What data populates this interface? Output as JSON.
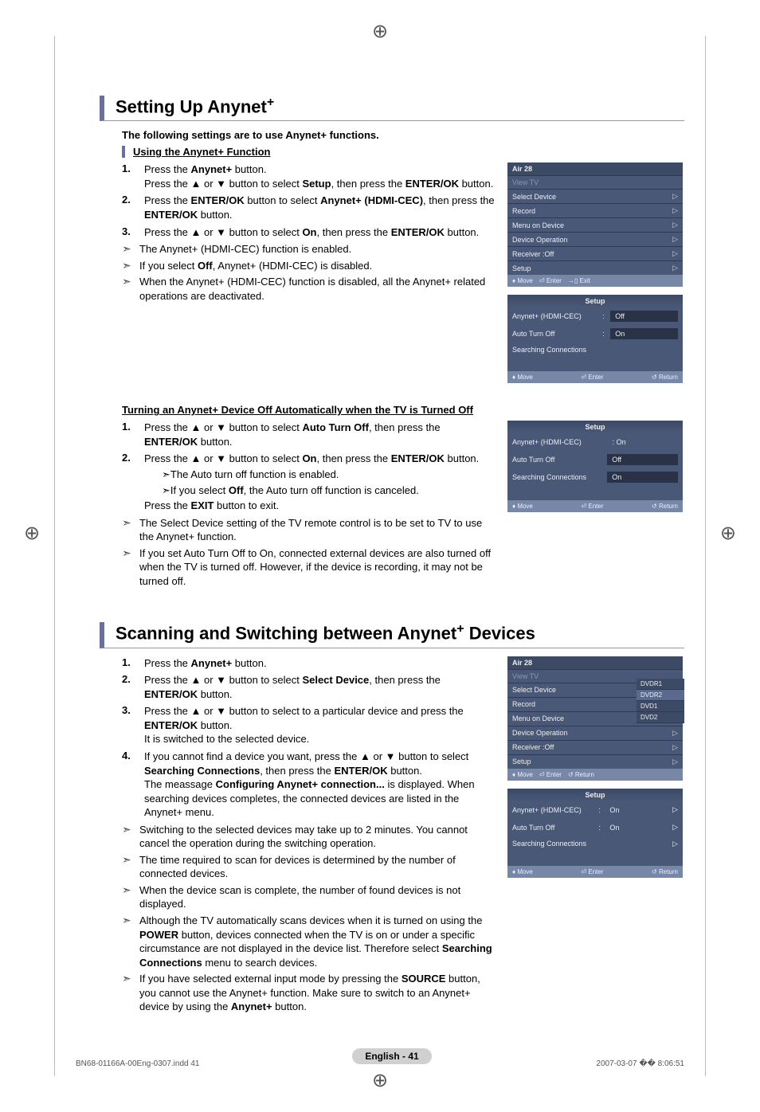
{
  "section1": {
    "title_a": "Setting Up Anynet",
    "title_sup": "+",
    "intro": "The following settings are to use Anynet+ functions.",
    "sub1": "Using the Anynet+ Function",
    "steps1": [
      {
        "n": "1.",
        "html": "Press the <b>Anynet+</b> button.<br>Press the ▲ or ▼ button to select <b>Setup</b>, then press the <b>ENTER/OK</b> button."
      },
      {
        "n": "2.",
        "html": "Press the <b>ENTER/OK</b> button to select <b>Anynet+ (HDMI-CEC)</b>, then press the <b>ENTER/OK</b> button."
      },
      {
        "n": "3.",
        "html": "Press the ▲ or ▼ button to select <b>On</b>, then press the <b>ENTER/OK</b> button."
      }
    ],
    "notes1": [
      "The Anynet+ (HDMI-CEC) function is enabled.",
      "If you select <b>Off</b>, Anynet+ (HDMI-CEC) is disabled.",
      "When the Anynet+ (HDMI-CEC) function is disabled, all the Anynet+ related operations are deactivated."
    ],
    "sub2": "Turning an Anynet+ Device Off Automatically when the TV is Turned Off",
    "steps2": [
      {
        "n": "1.",
        "html": "Press the ▲ or ▼ button to select <b>Auto Turn Off</b>, then press the <b>ENTER/OK</b> button."
      },
      {
        "n": "2.",
        "html": "Press the ▲ or ▼ button to select <b>On</b>, then press the <b>ENTER/OK</b> button.",
        "subnotes": [
          "The Auto turn off function is enabled.",
          "If you select <b>Off</b>, the Auto turn off function is canceled."
        ],
        "tail": "Press the <b>EXIT</b> button to exit."
      }
    ],
    "notes2": [
      "The Select Device setting of the TV remote control is to be set to TV to use the Anynet+ function.",
      "If you set Auto Turn Off to On, connected external devices are also turned off when the TV is turned off. However, if the device is recording, it may not be turned off."
    ]
  },
  "section2": {
    "title_a": "Scanning and Switching between Anynet",
    "title_sup": "+",
    "title_b": " Devices",
    "steps": [
      {
        "n": "1.",
        "html": "Press the <b>Anynet+</b> button."
      },
      {
        "n": "2.",
        "html": "Press the ▲ or ▼ button to select <b>Select Device</b>, then press the <b>ENTER/OK</b> button."
      },
      {
        "n": "3.",
        "html": "Press the ▲ or ▼ button to select to a particular device and press the <b>ENTER/OK</b> button.<br>It is switched to the selected device."
      },
      {
        "n": "4.",
        "html": "If you cannot find a device you want, press the ▲ or ▼ button to select <b>Searching Connections</b>, then press the <b>ENTER/OK</b> button.<br>The meassage <b>Configuring Anynet+ connection...</b> is displayed. When searching devices completes, the connected devices are listed in the Anynet+ menu."
      }
    ],
    "notes": [
      "Switching to the selected devices may take up to 2 minutes. You cannot cancel the operation during the switching operation.",
      "The time required to scan for devices is determined by the number of connected devices.",
      "When the device scan is complete, the number of found devices is not displayed.",
      "Although the TV automatically scans devices when it is turned on using the <b>POWER</b> button, devices connected when the TV is on or under a specific circumstance are not displayed in the device list. Therefore select <b>Searching Connections</b> menu to search devices.",
      "If you have selected external input mode by pressing the <b>SOURCE</b> button, you cannot use the Anynet+ function. Make sure to switch to an Anynet+ device by using the <b>Anynet+</b> button."
    ]
  },
  "osd1": {
    "hdr": "Air 28",
    "items": [
      "View TV",
      "Select Device",
      "Record",
      "Menu on Device",
      "Device Operation",
      "Receiver      :Off",
      "Setup"
    ],
    "foot": [
      "Move",
      "Enter",
      "Exit"
    ]
  },
  "osd2": {
    "hdr": "Setup",
    "rows": [
      {
        "lbl": "Anynet+ (HDMI-CEC)",
        "colon": ":",
        "val": "Off",
        "box": true
      },
      {
        "lbl": "Auto Turn Off",
        "colon": ":",
        "val": "On",
        "box": true
      },
      {
        "lbl": "Searching Connections"
      }
    ],
    "foot": [
      "Move",
      "Enter",
      "Return"
    ]
  },
  "osd3": {
    "hdr": "Setup",
    "rows": [
      {
        "lbl": "Anynet+ (HDMI-CEC)",
        "colon": ": On"
      },
      {
        "lbl": "Auto Turn Off",
        "val": "Off",
        "box": true
      },
      {
        "lbl": "Searching Connections",
        "val": "On",
        "box": true,
        "lblblank": true
      }
    ],
    "foot": [
      "Move",
      "Enter",
      "Return"
    ]
  },
  "osd4": {
    "hdr": "Air 28",
    "items": [
      "View TV",
      "Select Device",
      "Record",
      "Menu on Device",
      "Device Operation",
      "Receiver      :Off",
      "Setup"
    ],
    "submenu": [
      "DVDR1",
      "DVDR2",
      "DVD1",
      "DVD2"
    ],
    "foot": [
      "Move",
      "Enter",
      "Return"
    ]
  },
  "osd5": {
    "hdr": "Setup",
    "rows": [
      {
        "lbl": "Anynet+ (HDMI-CEC)",
        "colon": ":",
        "val": "On",
        "tri": true
      },
      {
        "lbl": "Auto Turn Off",
        "colon": ":",
        "val": "On",
        "tri": true
      },
      {
        "lbl": "Searching Connections",
        "tri": true
      }
    ],
    "foot": [
      "Move",
      "Enter",
      "Return"
    ]
  },
  "pagefoot": "English - 41",
  "bottom": {
    "left": "BN68-01166A-00Eng-0307.indd   41",
    "right": "2007-03-07   �� 8:06:51"
  }
}
